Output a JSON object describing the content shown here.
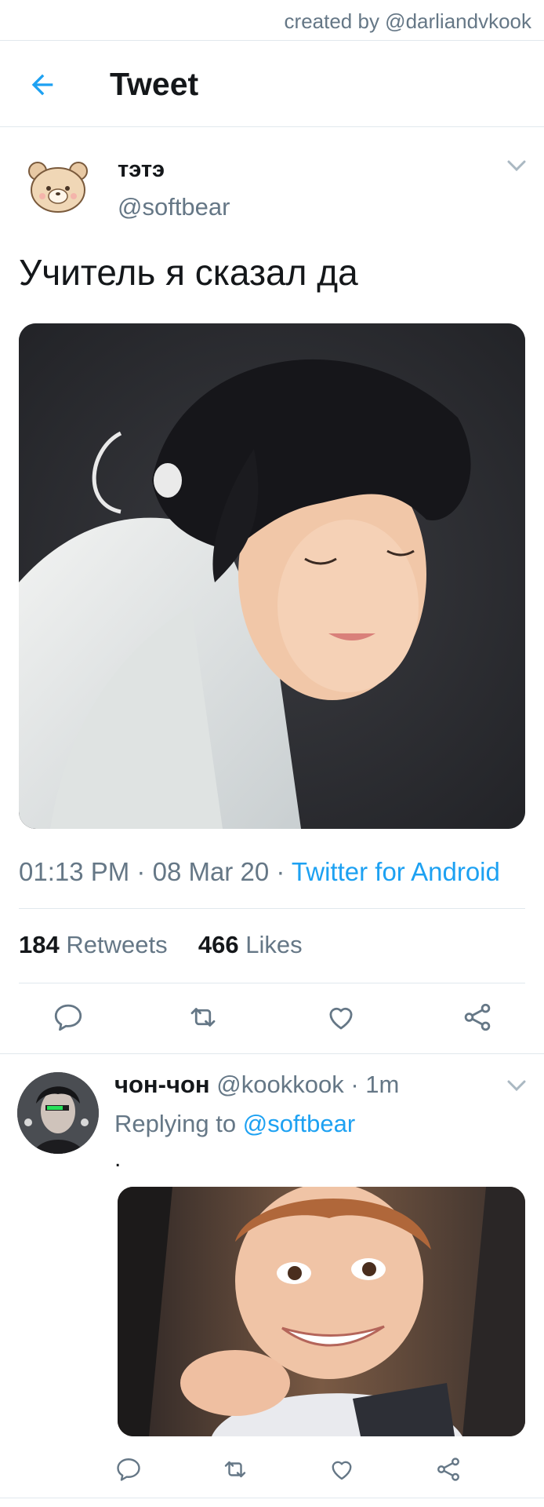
{
  "watermark": "created by @darliandvkook",
  "header": {
    "title": "Tweet"
  },
  "tweet": {
    "name": "тэтэ",
    "handle": "@softbear",
    "text": "Учитель я сказал да",
    "time": "01:13 PM",
    "date": "08 Mar 20",
    "source": "Twitter for Android",
    "retweets_count": "184",
    "retweets_label": "Retweets",
    "likes_count": "466",
    "likes_label": "Likes"
  },
  "reply": {
    "name": "чон-чон",
    "handle": "@kookkook",
    "age": "1m",
    "replying_label": "Replying to",
    "replying_to": "@softbear",
    "text": "."
  },
  "icons": [
    "back-arrow-icon",
    "chevron-down-icon",
    "reply-icon",
    "retweet-icon",
    "like-icon",
    "share-icon"
  ],
  "colors": {
    "accent": "#1da1f2",
    "secondary_text": "#657786",
    "divider": "#e1e8ed"
  }
}
